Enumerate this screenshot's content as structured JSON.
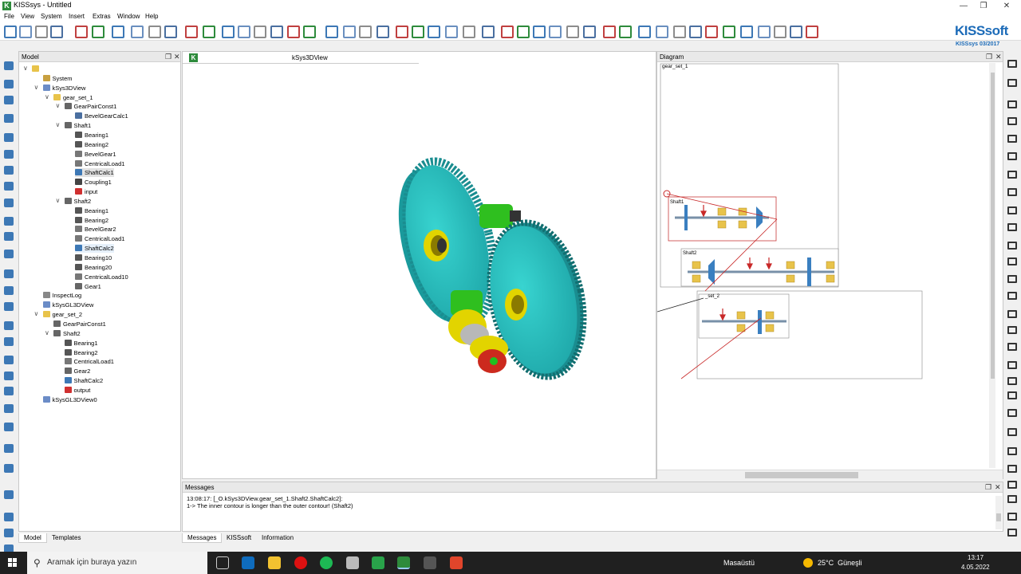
{
  "window": {
    "title": "KISSsys - Untitled"
  },
  "menu": [
    "File",
    "View",
    "System",
    "Insert",
    "Extras",
    "Window",
    "Help"
  ],
  "brand": {
    "logo": "KISSsoft",
    "version": "KISSsys 03/2017",
    "color": "#1c6bb8"
  },
  "model_panel": {
    "title": "Model",
    "tree": [
      {
        "label": "",
        "depth": 0,
        "icon": "folder-icon"
      },
      {
        "label": "System",
        "depth": 1,
        "icon": "system-icon"
      },
      {
        "label": "kSys3DView",
        "depth": 1,
        "icon": "view-icon"
      },
      {
        "label": "gear_set_1",
        "depth": 2,
        "icon": "folder-icon"
      },
      {
        "label": "GearPairConst1",
        "depth": 3,
        "icon": "gearpair-icon"
      },
      {
        "label": "BevelGearCalc1",
        "depth": 4,
        "icon": "calc-icon"
      },
      {
        "label": "Shaft1",
        "depth": 3,
        "icon": "shaft-icon"
      },
      {
        "label": "Bearing1",
        "depth": 4,
        "icon": "bearing-icon"
      },
      {
        "label": "Bearing2",
        "depth": 4,
        "icon": "bearing-icon"
      },
      {
        "label": "BevelGear1",
        "depth": 4,
        "icon": "bevelgear-icon"
      },
      {
        "label": "CentricalLoad1",
        "depth": 4,
        "icon": "load-icon"
      },
      {
        "label": "ShaftCalc1",
        "depth": 4,
        "icon": "shaftcalc-icon"
      },
      {
        "label": "Coupling1",
        "depth": 4,
        "icon": "coupling-icon"
      },
      {
        "label": "input",
        "depth": 4,
        "icon": "input-icon"
      },
      {
        "label": "Shaft2",
        "depth": 3,
        "icon": "shaft-icon"
      },
      {
        "label": "Bearing1",
        "depth": 4,
        "icon": "bearing-icon"
      },
      {
        "label": "Bearing2",
        "depth": 4,
        "icon": "bearing-icon"
      },
      {
        "label": "BevelGear2",
        "depth": 4,
        "icon": "bevelgear-icon"
      },
      {
        "label": "CentricalLoad1",
        "depth": 4,
        "icon": "load-icon"
      },
      {
        "label": "ShaftCalc2",
        "depth": 4,
        "icon": "shaftcalc-icon"
      },
      {
        "label": "Bearing10",
        "depth": 4,
        "icon": "bearing-icon"
      },
      {
        "label": "Bearing20",
        "depth": 4,
        "icon": "bearing-icon"
      },
      {
        "label": "CentricalLoad10",
        "depth": 4,
        "icon": "load-icon"
      },
      {
        "label": "Gear1",
        "depth": 4,
        "icon": "gear-icon"
      },
      {
        "label": "InspectLog",
        "depth": 1,
        "icon": "log-icon"
      },
      {
        "label": "kSysGL3DView",
        "depth": 1,
        "icon": "view-icon"
      },
      {
        "label": "gear_set_2",
        "depth": 1,
        "icon": "folder-icon"
      },
      {
        "label": "GearPairConst1",
        "depth": 2,
        "icon": "gearpair-icon"
      },
      {
        "label": "Shaft2",
        "depth": 2,
        "icon": "shaft-icon"
      },
      {
        "label": "Bearing1",
        "depth": 3,
        "icon": "bearing-icon"
      },
      {
        "label": "Bearing2",
        "depth": 3,
        "icon": "bearing-icon"
      },
      {
        "label": "CentricalLoad1",
        "depth": 3,
        "icon": "load-icon"
      },
      {
        "label": "Gear2",
        "depth": 3,
        "icon": "gear-icon"
      },
      {
        "label": "ShaftCalc2",
        "depth": 3,
        "icon": "shaftcalc-icon"
      },
      {
        "label": "output",
        "depth": 3,
        "icon": "output-icon"
      },
      {
        "label": "kSysGL3DView0",
        "depth": 1,
        "icon": "view-icon"
      }
    ],
    "tabs": [
      "Model",
      "Templates"
    ]
  },
  "view3d": {
    "tab_label": "kSys3DView"
  },
  "diagram": {
    "title": "Diagram",
    "group1_label": "gear_set_1",
    "shaft1_label": "Shaft1",
    "shaft2_label": "Shaft2",
    "group2_label": "_set_2"
  },
  "messages": {
    "title": "Messages",
    "lines": [
      "13:08:17: [_O.kSys3DView.gear_set_1.Shaft2.ShaftCalc2]:",
      "1-> The inner contour is longer than the outer contour! (Shaft2)"
    ],
    "tabs": [
      "Messages",
      "KISSsoft",
      "Information"
    ]
  },
  "taskbar": {
    "search_placeholder": "Aramak için buraya yazın",
    "desktop": "Masaüstü",
    "weather": "25°C  Güneşli",
    "time": "13:17",
    "date": "4.05.2022"
  }
}
